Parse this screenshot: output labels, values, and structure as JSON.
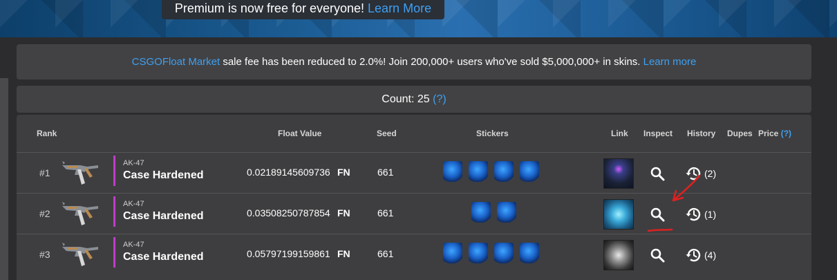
{
  "banner": {
    "text": "Premium is now free for everyone!",
    "link": "Learn More"
  },
  "fee_notice": {
    "brand": "CSGOFloat Market",
    "text": " sale fee has been reduced to 2.0%! Join 200,000+ users who've sold $5,000,000+ in skins. ",
    "link": "Learn more"
  },
  "count": {
    "label": "Count: 25",
    "help": "(?)"
  },
  "table": {
    "headers": {
      "rank": "Rank",
      "float": "Float Value",
      "seed": "Seed",
      "stickers": "Stickers",
      "link": "Link",
      "inspect": "Inspect",
      "history": "History",
      "dupes": "Dupes",
      "price": "Price",
      "price_help": "(?)"
    },
    "rows": [
      {
        "rank": "#1",
        "weapon": "AK-47",
        "skin": "Case Hardened",
        "float": "0.02189145609736",
        "wear": "FN",
        "seed": "661",
        "stickers": 4,
        "history": "(2)"
      },
      {
        "rank": "#2",
        "weapon": "AK-47",
        "skin": "Case Hardened",
        "float": "0.03508250787854",
        "wear": "FN",
        "seed": "661",
        "stickers": 2,
        "history": "(1)"
      },
      {
        "rank": "#3",
        "weapon": "AK-47",
        "skin": "Case Hardened",
        "float": "0.05797199159861",
        "wear": "FN",
        "seed": "661",
        "stickers": 4,
        "history": "(4)"
      }
    ]
  },
  "colors": {
    "accent": "#3ea0f2",
    "rarity": "#c03cc9",
    "annotation": "#e02020"
  },
  "icons": {
    "inspect": "magnifier-icon",
    "history": "history-clock-icon",
    "weapon": "ak47-icon"
  }
}
